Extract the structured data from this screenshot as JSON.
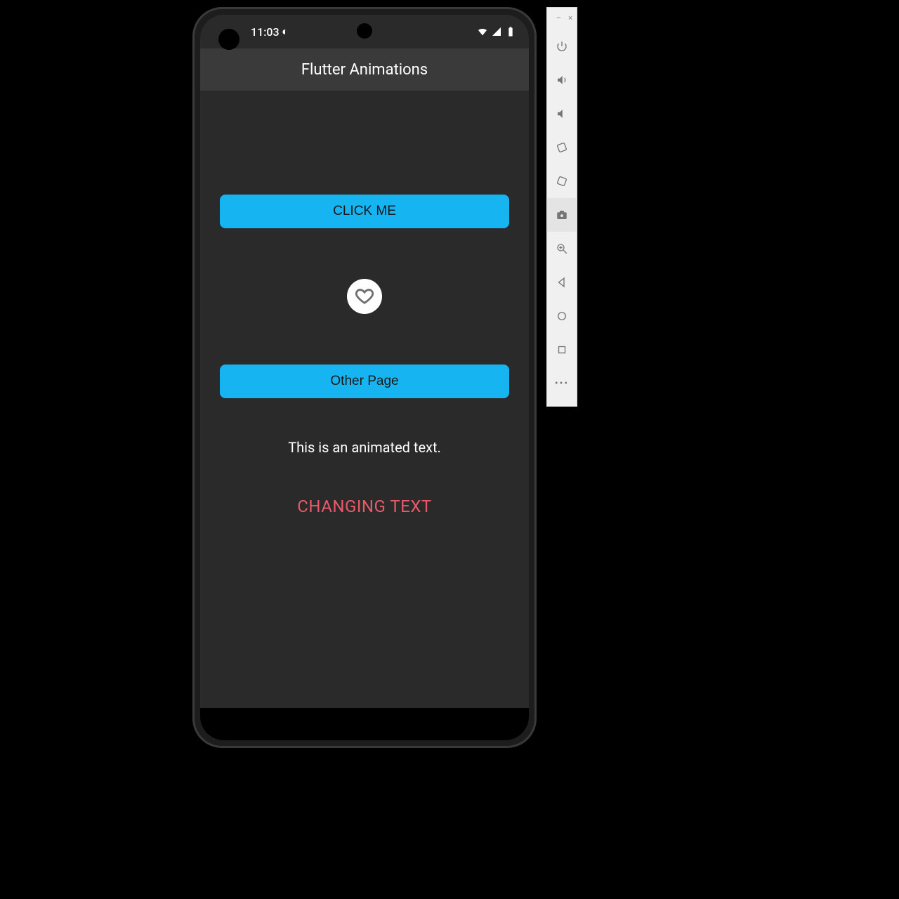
{
  "status_bar": {
    "time": "11:03",
    "indicator_glyph": "◐",
    "wifi": true,
    "signal": true,
    "battery": true
  },
  "app_bar": {
    "title": "Flutter Animations"
  },
  "body": {
    "click_button_label": "CLICK ME",
    "heart_icon": "heart-outline",
    "other_page_button_label": "Other Page",
    "animated_caption": "This is an animated text.",
    "changing_text": "CHANGING TEXT"
  },
  "colors": {
    "accent": "#17b4f2",
    "changing_text_color": "#e85a6a",
    "app_bg": "#2a2a2a"
  },
  "emulator_toolbar": {
    "window_controls": {
      "minimize": "–",
      "close": "×"
    },
    "buttons": [
      {
        "id": "power",
        "icon": "power-icon",
        "selected": false
      },
      {
        "id": "volume-up",
        "icon": "volume-up-icon",
        "selected": false
      },
      {
        "id": "volume-down",
        "icon": "volume-down-icon",
        "selected": false
      },
      {
        "id": "rotate-left",
        "icon": "rotate-left-icon",
        "selected": false
      },
      {
        "id": "rotate-right",
        "icon": "rotate-right-icon",
        "selected": false
      },
      {
        "id": "screenshot",
        "icon": "camera-icon",
        "selected": true
      },
      {
        "id": "zoom",
        "icon": "zoom-icon",
        "selected": false
      },
      {
        "id": "back",
        "icon": "back-icon",
        "selected": false
      },
      {
        "id": "home",
        "icon": "home-icon",
        "selected": false
      },
      {
        "id": "overview",
        "icon": "overview-icon",
        "selected": false
      },
      {
        "id": "more",
        "icon": "more-icon",
        "selected": false
      }
    ]
  }
}
